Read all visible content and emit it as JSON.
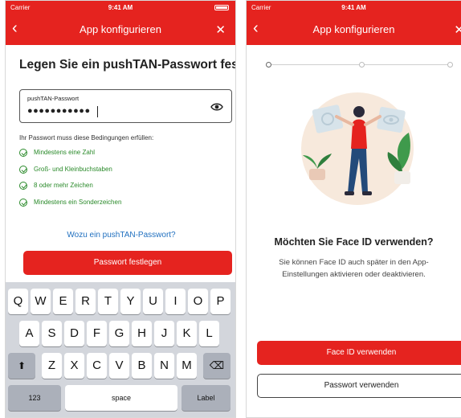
{
  "statusbar": {
    "carrier": "Carrier",
    "time": "9:41 AM"
  },
  "left": {
    "nav_title": "App konfigurieren",
    "heading": "Legen Sie ein pushTAN-Passwort fest",
    "password_field": {
      "label": "pushTAN-Passwort",
      "value": "●●●●●●●●●●●"
    },
    "requirements_title": "Ihr Passwort muss diese Bedingungen erfüllen:",
    "requirements": [
      "Mindestens eine Zahl",
      "Groß- und Kleinbuchstaben",
      "8 oder mehr Zeichen",
      "Mindestens ein Sonderzeichen"
    ],
    "info_link": "Wozu ein pushTAN-Passwort?",
    "submit_button": "Passwort festlegen",
    "keyboard": {
      "row1": [
        "Q",
        "W",
        "E",
        "R",
        "T",
        "Y",
        "U",
        "I",
        "O",
        "P"
      ],
      "row2": [
        "A",
        "S",
        "D",
        "F",
        "G",
        "H",
        "J",
        "K",
        "L"
      ],
      "row3": [
        "Z",
        "X",
        "C",
        "V",
        "B",
        "N",
        "M"
      ],
      "shift": "⬆",
      "backspace": "⌫",
      "numbers": "123",
      "space": "space",
      "return": "Label"
    }
  },
  "right": {
    "nav_title": "App konfigurieren",
    "question": "Möchten Sie Face ID verwenden?",
    "description": "Sie können Face ID auch später in den App-Einstellungen aktivieren oder deaktivieren.",
    "primary_button": "Face ID verwenden",
    "secondary_button": "Passwort verwenden",
    "stepper_active": 1,
    "stepper_total": 3
  },
  "colors": {
    "brand_red": "#e5231f",
    "success_green": "#2a8a2a",
    "link_blue": "#1f6fbf"
  }
}
